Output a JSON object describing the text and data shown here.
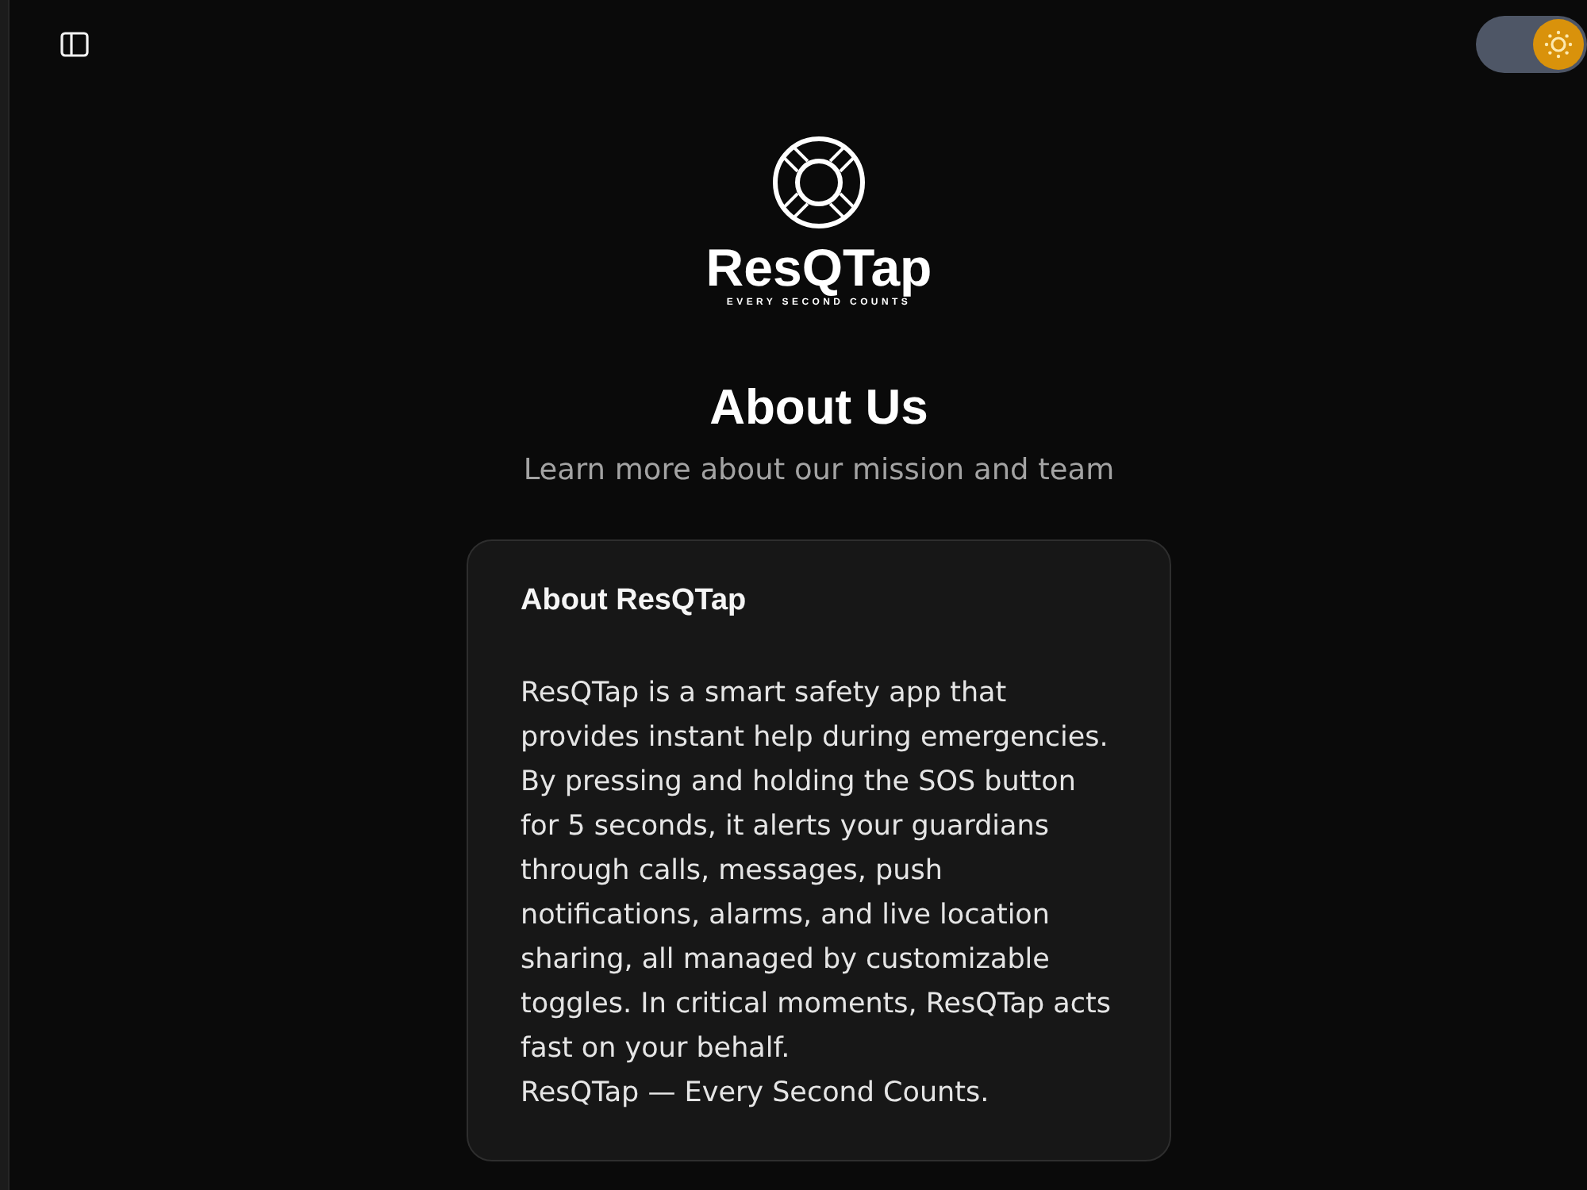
{
  "header": {
    "theme_toggle": {
      "on": true
    }
  },
  "logo": {
    "name": "ResQTap",
    "tagline": "EVERY SECOND COUNTS"
  },
  "page": {
    "title": "About Us",
    "subtitle": "Learn more about our mission and team"
  },
  "card": {
    "title": "About ResQTap",
    "paragraphs": [
      "ResQTap is a smart safety app that provides instant help during emergencies. By pressing and holding the SOS button for 5 seconds, it alerts your guardians through calls, messages, push notifications, alarms, and live location sharing, all managed by customizable toggles. In critical moments, ResQTap acts fast on your behalf.",
      "ResQTap — Every Second Counts."
    ]
  }
}
